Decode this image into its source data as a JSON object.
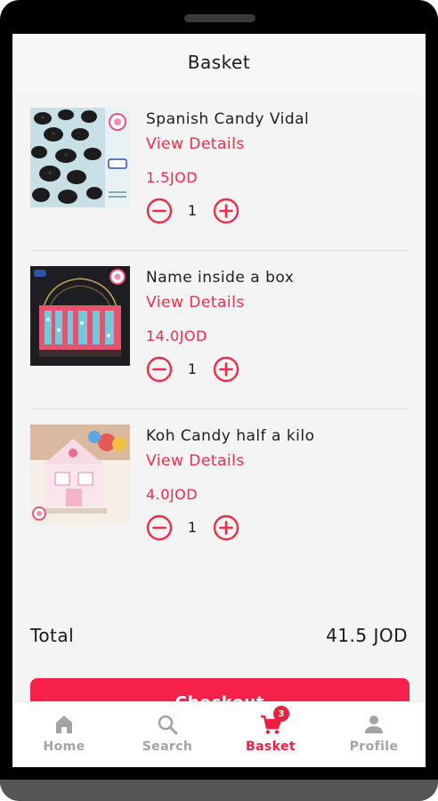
{
  "header": {
    "title": "Basket"
  },
  "basket": {
    "items": [
      {
        "name": "Spanish Candy Vidal",
        "details_label": "View Details",
        "price": "1.5JOD",
        "quantity": "1"
      },
      {
        "name": "Name inside a box",
        "details_label": "View Details",
        "price": "14.0JOD",
        "quantity": "1"
      },
      {
        "name": "Koh Candy half a kilo",
        "details_label": "View Details",
        "price": "4.0JOD",
        "quantity": "1"
      }
    ],
    "total_label": "Total",
    "total_value": "41.5 JOD",
    "checkout_label": "Checkout"
  },
  "tabbar": {
    "tabs": [
      {
        "label": "Home",
        "icon": "home-icon"
      },
      {
        "label": "Search",
        "icon": "search-icon"
      },
      {
        "label": "Basket",
        "icon": "cart-icon",
        "badge": "3",
        "active": true
      },
      {
        "label": "Profile",
        "icon": "person-icon"
      }
    ]
  },
  "colors": {
    "accent": "#F5214A",
    "active_tab": "#E8213F",
    "inactive_tab": "#A3A3A3",
    "background": "#F4F4F4"
  }
}
